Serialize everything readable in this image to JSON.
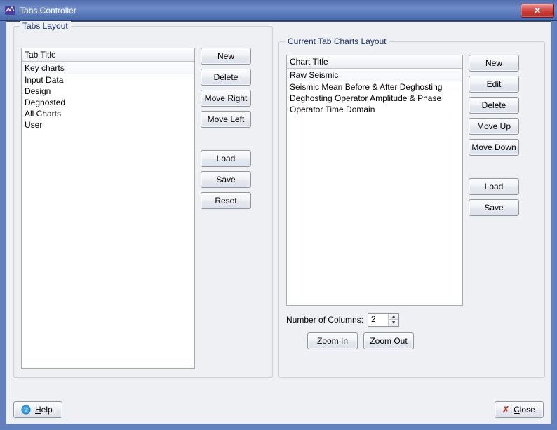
{
  "window": {
    "title": "Tabs Controller"
  },
  "tabs_layout": {
    "legend": "Tabs Layout",
    "header": "Tab Title",
    "items": [
      "Key charts",
      "Input Data",
      "Design",
      "Deghosted",
      "All Charts",
      "User"
    ],
    "selected_index": 0,
    "buttons": {
      "new": "New",
      "delete": "Delete",
      "move_right": "Move Right",
      "move_left": "Move Left",
      "load": "Load",
      "save": "Save",
      "reset": "Reset"
    }
  },
  "charts_layout": {
    "legend": "Current Tab Charts Layout",
    "header": "Chart Title",
    "items": [
      "Raw Seismic",
      "Seismic Mean Before & After Deghosting",
      "Deghosting Operator Amplitude & Phase",
      "Operator Time Domain"
    ],
    "selected_index": 0,
    "buttons": {
      "new": "New",
      "edit": "Edit",
      "delete": "Delete",
      "move_up": "Move Up",
      "move_down": "Move Down",
      "load": "Load",
      "save": "Save"
    },
    "ncols_label": "Number of Columns:",
    "ncols_value": "2",
    "zoom_in": "Zoom In",
    "zoom_out": "Zoom Out"
  },
  "bottom": {
    "help": "Help",
    "close": "Close"
  }
}
